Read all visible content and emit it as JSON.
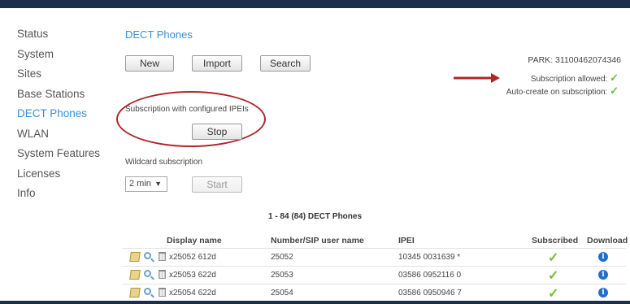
{
  "sidebar": {
    "items": [
      {
        "label": "Status"
      },
      {
        "label": "System"
      },
      {
        "label": "Sites"
      },
      {
        "label": "Base Stations"
      },
      {
        "label": "DECT Phones"
      },
      {
        "label": "WLAN"
      },
      {
        "label": "System Features"
      },
      {
        "label": "Licenses"
      },
      {
        "label": "Info"
      }
    ],
    "active": "DECT Phones"
  },
  "main": {
    "title": "DECT Phones",
    "buttons": {
      "new": "New",
      "import": "Import",
      "search": "Search"
    },
    "park_label": "PARK: 31100462074346",
    "subscription_allowed": "Subscription allowed:",
    "auto_create": "Auto-create on subscription:",
    "check_glyph": "✓",
    "configured_label": "Subscription with configured IPEIs",
    "stop_button": "Stop",
    "wildcard_label": "Wildcard subscription",
    "wildcard_select": "2 min",
    "start_button": "Start",
    "count_text": "1 - 84 (84) DECT Phones"
  },
  "table": {
    "headers": {
      "display_name": "Display name",
      "number": "Number/SIP user name",
      "ipei": "IPEI",
      "subscribed": "Subscribed",
      "download": "Download"
    },
    "rows": [
      {
        "display_name": "x25052 612d",
        "number": "25052",
        "ipei": "10345 0031639 *",
        "subscribed": "✓",
        "download": "i"
      },
      {
        "display_name": "x25053 622d",
        "number": "25053",
        "ipei": "03586 0952116 0",
        "subscribed": "✓",
        "download": "i"
      },
      {
        "display_name": "x25054 622d",
        "number": "25054",
        "ipei": "03586 0950946 7",
        "subscribed": "✓",
        "download": "i"
      }
    ]
  },
  "colors": {
    "accent": "#3a8fd6",
    "header_bar": "#1c2e4a",
    "annotation_red": "#b0262a",
    "check_green": "#6cbf3a",
    "info_blue": "#1f6fd0"
  }
}
